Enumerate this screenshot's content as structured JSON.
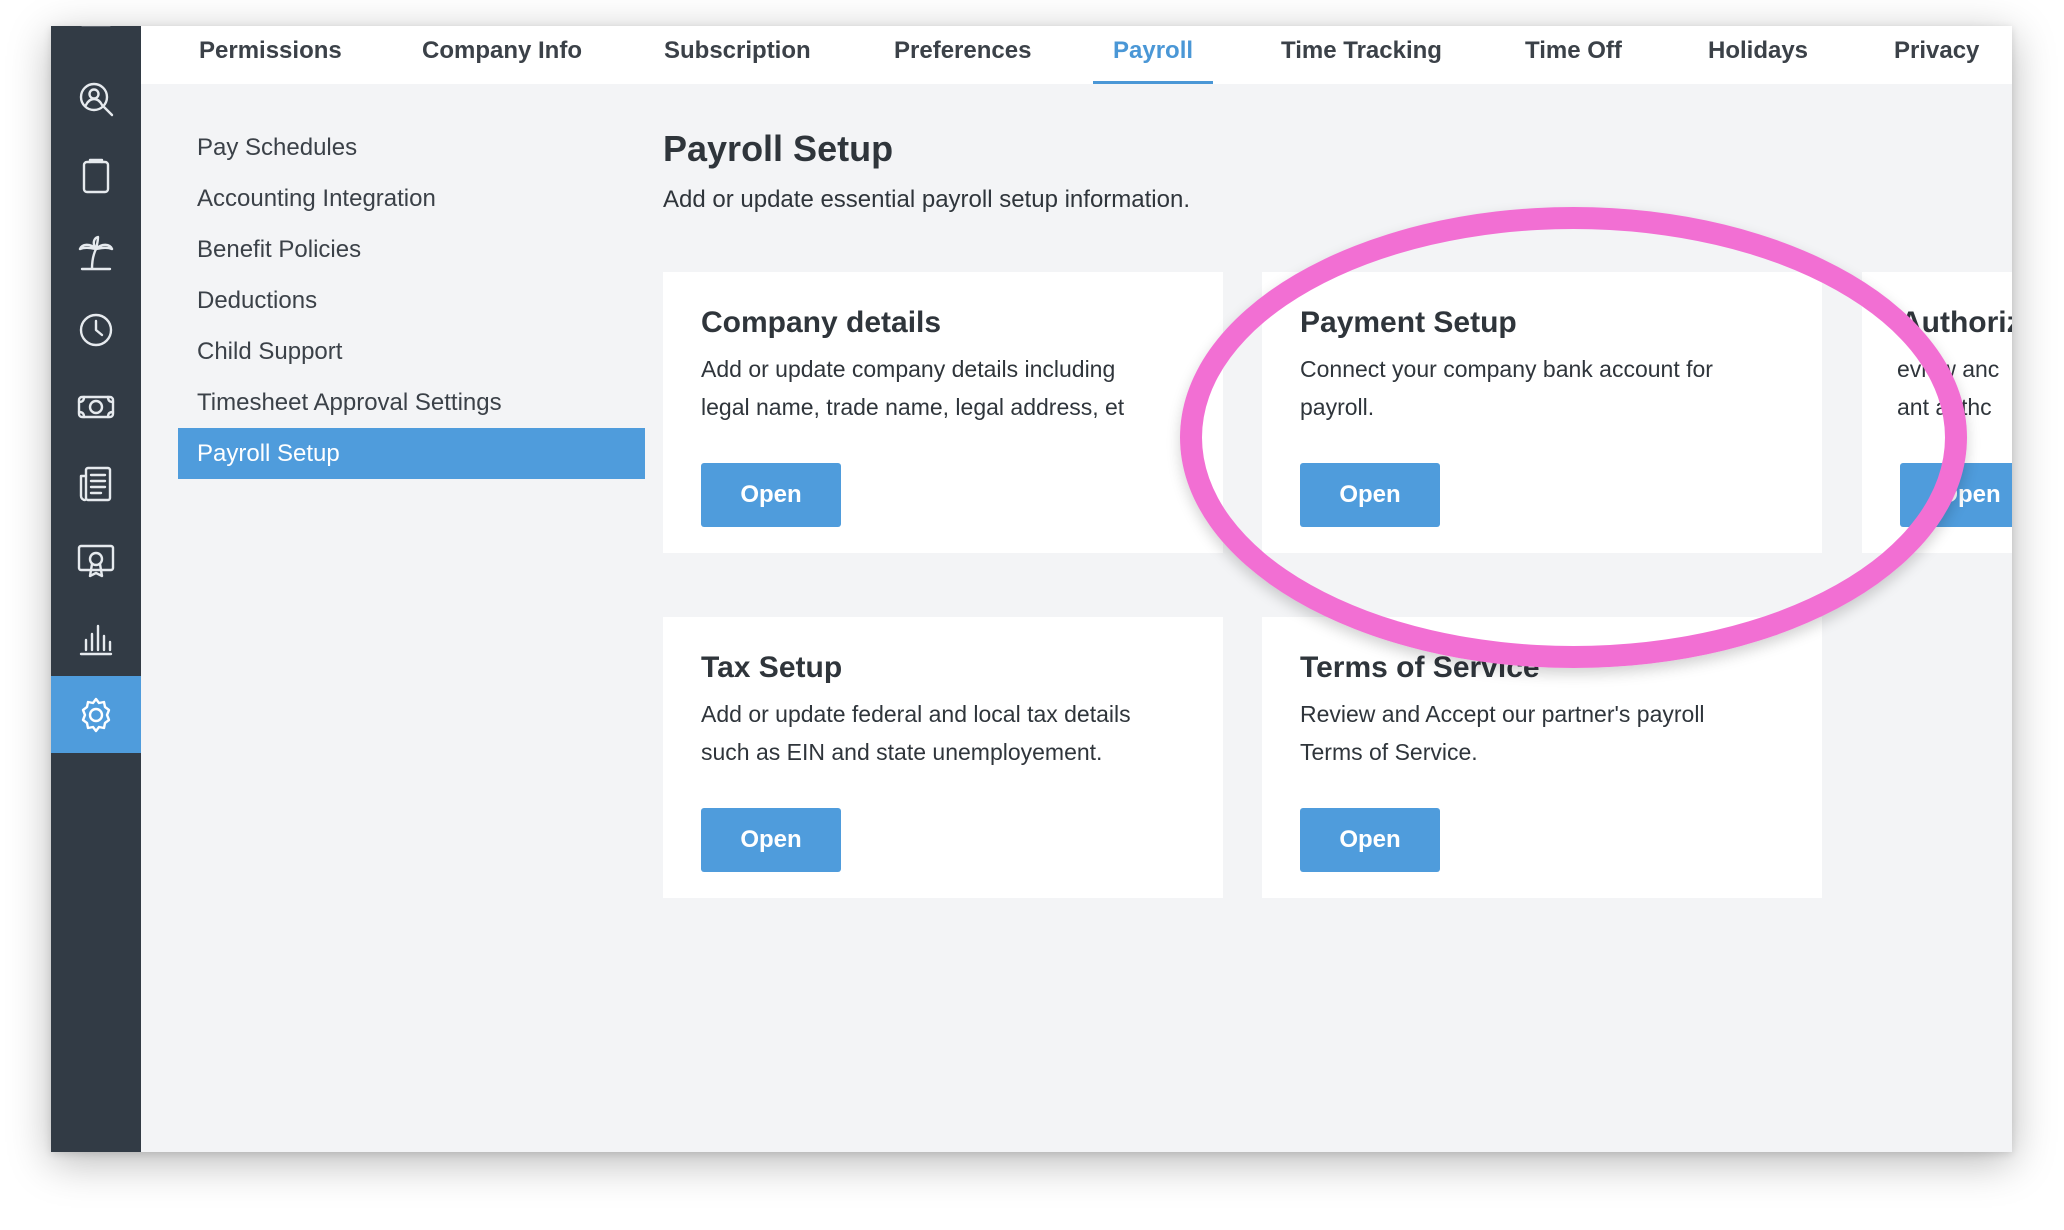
{
  "tabs": [
    {
      "label": "Permissions",
      "active": false
    },
    {
      "label": "Company Info",
      "active": false
    },
    {
      "label": "Subscription",
      "active": false
    },
    {
      "label": "Preferences",
      "active": false
    },
    {
      "label": "Payroll",
      "active": true
    },
    {
      "label": "Time Tracking",
      "active": false
    },
    {
      "label": "Time Off",
      "active": false
    },
    {
      "label": "Holidays",
      "active": false
    },
    {
      "label": "Privacy",
      "active": false
    }
  ],
  "rail": {
    "icons": [
      "org-chart-icon",
      "person-search-icon",
      "clipboard-icon",
      "palm-tree-icon",
      "clock-icon",
      "money-icon",
      "news-icon",
      "certificate-icon",
      "bar-chart-icon",
      "gear-icon"
    ],
    "active": "gear-icon"
  },
  "subnav": {
    "items": [
      "Pay Schedules",
      "Accounting Integration",
      "Benefit Policies",
      "Deductions",
      "Child Support",
      "Timesheet Approval Settings",
      "Payroll Setup"
    ],
    "active": "Payroll Setup"
  },
  "page": {
    "title": "Payroll Setup",
    "subtitle": "Add or update essential payroll setup information."
  },
  "cards": [
    {
      "title": "Company details",
      "desc_line1": "Add or update company details including",
      "desc_line2": "legal name, trade name, legal address, et",
      "button": "Open"
    },
    {
      "title": "Payment Setup",
      "desc_line1": "Connect your company bank account for",
      "desc_line2": "payroll.",
      "button": "Open"
    },
    {
      "title": "Authoriz",
      "desc_line1": "eview anc",
      "desc_line2": "ant authc",
      "button": "Open"
    },
    {
      "title": "Tax Setup",
      "desc_line1": "Add or update federal and local tax details",
      "desc_line2": "such as EIN and state unemployement.",
      "button": "Open"
    },
    {
      "title": "Terms of Service",
      "desc_line1": "Review and Accept our partner's payroll",
      "desc_line2": "Terms of Service.",
      "button": "Open"
    }
  ],
  "colors": {
    "accent": "#4f9cdc",
    "rail": "#323b45",
    "highlight": "#f26fd3"
  }
}
